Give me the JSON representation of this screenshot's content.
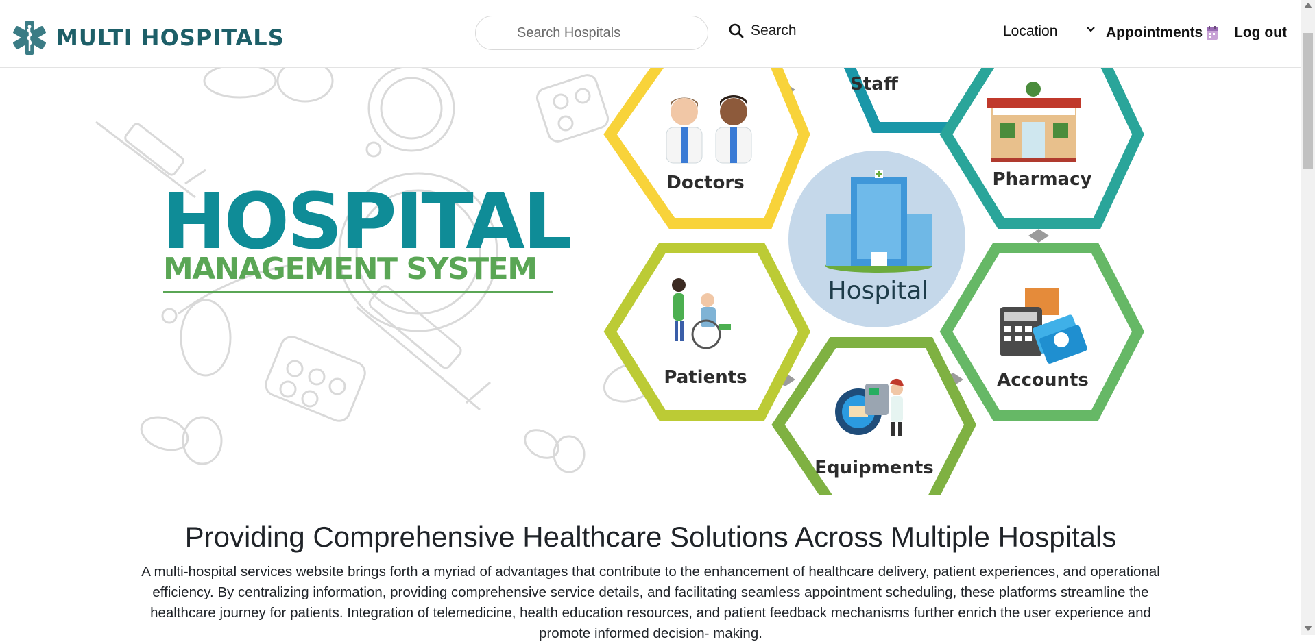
{
  "header": {
    "brand_title": "MULTI HOSPITALS",
    "search_placeholder": "Search Hospitals",
    "search_button_label": "Search",
    "nav": {
      "location": "Location",
      "appointments": "Appointments",
      "logout": "Log out"
    }
  },
  "hero": {
    "title": "HOSPITAL",
    "subtitle": "MANAGEMENT SYSTEM",
    "hub_label": "Hospital",
    "modules": {
      "doctors": "Doctors",
      "staff": "Staff",
      "pharmacy": "Pharmacy",
      "patients": "Patients",
      "accounts": "Accounts",
      "equipments": "Equipments"
    }
  },
  "content": {
    "heading": "Providing Comprehensive Healthcare Solutions Across Multiple Hospitals",
    "body": "A multi-hospital services website brings forth a myriad of advantages that contribute to the enhancement of healthcare delivery, patient experiences, and operational efficiency. By centralizing information, providing comprehensive service details, and facilitating seamless appointment scheduling, these platforms streamline the healthcare journey for patients. Integration of telemedicine, health education resources, and patient feedback mechanisms further enrich the user experience and promote informed decision- making."
  },
  "colors": {
    "brand": "#1d5f68",
    "hero_title": "#0f8c97",
    "hero_subtitle": "#5aa655",
    "hex_doctors": "#f8d33a",
    "hex_staff": "#1a97a8",
    "hex_pharmacy": "#2aa59a",
    "hex_patients": "#bccb35",
    "hex_accounts": "#66b866",
    "hex_equipments": "#7fb142",
    "hub": "#c5d8ea"
  },
  "icons": [
    "medical-star-of-life-icon",
    "search-icon",
    "chevron-down-icon",
    "calendar-icon"
  ]
}
